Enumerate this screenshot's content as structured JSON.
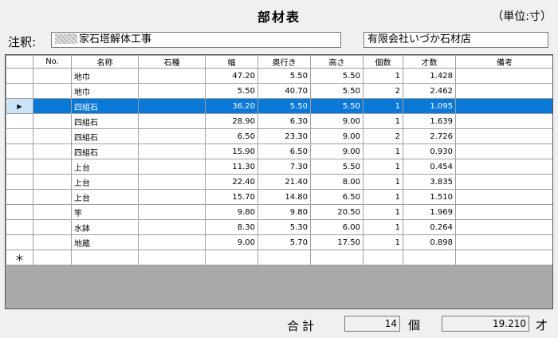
{
  "title": "部材表",
  "unit": "（単位:寸）",
  "note": {
    "label": "注釈:",
    "value": "家石塔解体工事",
    "shop": "有限会社いづか石材店"
  },
  "columns": [
    "",
    "No.",
    "名称",
    "石種",
    "幅",
    "奥行き",
    "高さ",
    "個数",
    "才数",
    "備考"
  ],
  "rows": [
    {
      "sel": "",
      "no": "",
      "name": "地巾",
      "stone": "",
      "w": "47.20",
      "d": "5.50",
      "h": "5.50",
      "qty": "1",
      "sai": "1.428",
      "note": ""
    },
    {
      "sel": "",
      "no": "",
      "name": "地巾",
      "stone": "",
      "w": "5.50",
      "d": "40.70",
      "h": "5.50",
      "qty": "2",
      "sai": "2.462",
      "note": ""
    },
    {
      "sel": "▶",
      "no": "",
      "name": "四組石",
      "stone": "",
      "w": "36.20",
      "d": "5.50",
      "h": "5.50",
      "qty": "1",
      "sai": "1.095",
      "note": ""
    },
    {
      "sel": "",
      "no": "",
      "name": "四組石",
      "stone": "",
      "w": "28.90",
      "d": "6.30",
      "h": "9.00",
      "qty": "1",
      "sai": "1.639",
      "note": ""
    },
    {
      "sel": "",
      "no": "",
      "name": "四組石",
      "stone": "",
      "w": "6.50",
      "d": "23.30",
      "h": "9.00",
      "qty": "2",
      "sai": "2.726",
      "note": ""
    },
    {
      "sel": "",
      "no": "",
      "name": "四組石",
      "stone": "",
      "w": "15.90",
      "d": "6.50",
      "h": "9.00",
      "qty": "1",
      "sai": "0.930",
      "note": ""
    },
    {
      "sel": "",
      "no": "",
      "name": "上台",
      "stone": "",
      "w": "11.30",
      "d": "7.30",
      "h": "5.50",
      "qty": "1",
      "sai": "0.454",
      "note": ""
    },
    {
      "sel": "",
      "no": "",
      "name": "上台",
      "stone": "",
      "w": "22.40",
      "d": "21.40",
      "h": "8.00",
      "qty": "1",
      "sai": "3.835",
      "note": ""
    },
    {
      "sel": "",
      "no": "",
      "name": "上台",
      "stone": "",
      "w": "15.70",
      "d": "14.80",
      "h": "6.50",
      "qty": "1",
      "sai": "1.510",
      "note": ""
    },
    {
      "sel": "",
      "no": "",
      "name": "竿",
      "stone": "",
      "w": "9.80",
      "d": "9.80",
      "h": "20.50",
      "qty": "1",
      "sai": "1.969",
      "note": ""
    },
    {
      "sel": "",
      "no": "",
      "name": "水鉢",
      "stone": "",
      "w": "8.30",
      "d": "5.30",
      "h": "6.00",
      "qty": "1",
      "sai": "0.264",
      "note": ""
    },
    {
      "sel": "",
      "no": "",
      "name": "地蔵",
      "stone": "",
      "w": "9.00",
      "d": "5.70",
      "h": "17.50",
      "qty": "1",
      "sai": "0.898",
      "note": ""
    }
  ],
  "new_row_marker": "＊",
  "selected_index": 2,
  "totals": {
    "label": "合計",
    "count": "14",
    "count_unit": "個",
    "sai": "19.210",
    "sai_unit": "才"
  }
}
